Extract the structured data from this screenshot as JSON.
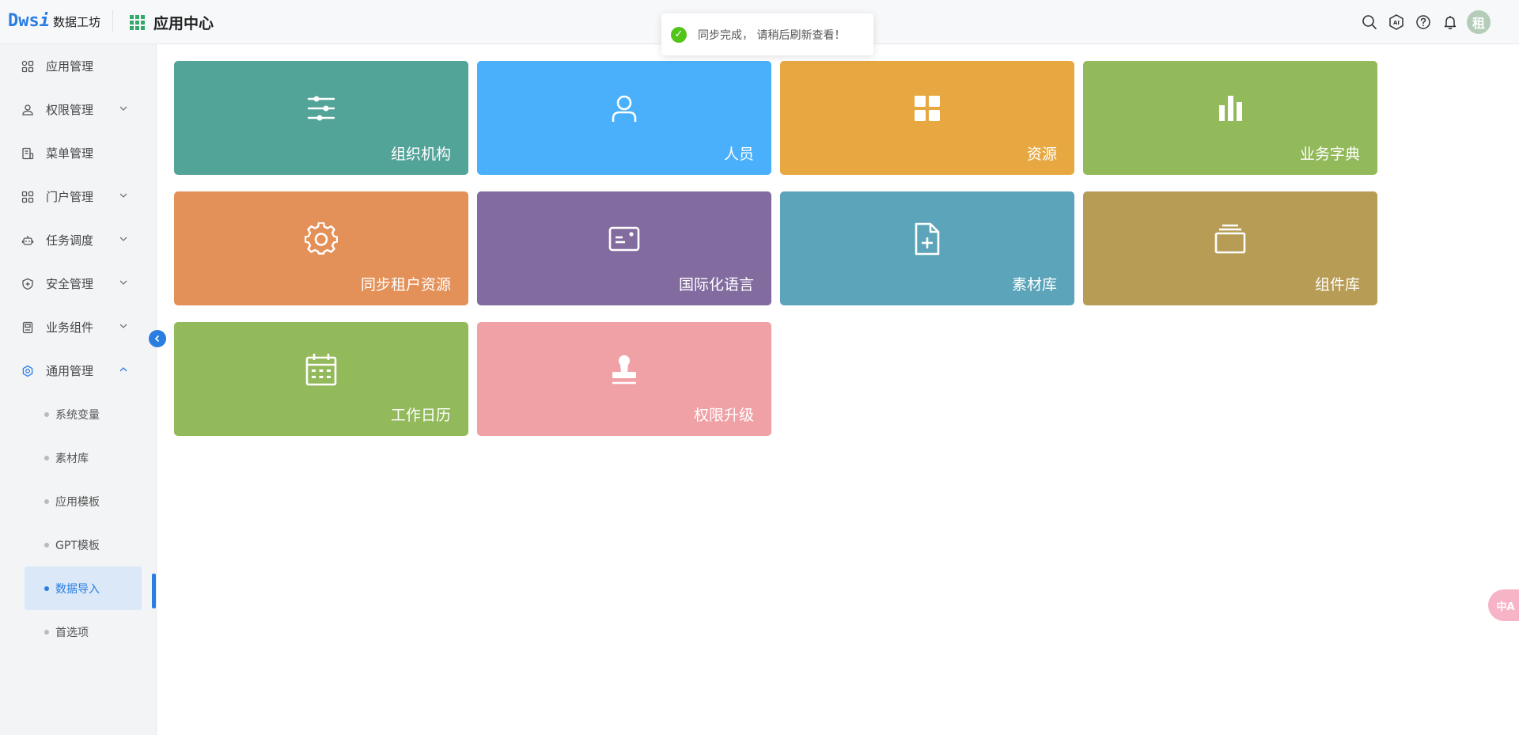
{
  "header": {
    "logo_mark": "Dws",
    "logo_mark_i": "i",
    "logo_text": "数据工坊",
    "app_title": "应用中心",
    "avatar_text": "租"
  },
  "toast": {
    "message": "同步完成， 请稍后刷新查看！"
  },
  "sidebar": {
    "items": [
      {
        "label": "应用管理",
        "icon": "apps-icon",
        "expandable": false
      },
      {
        "label": "权限管理",
        "icon": "user-stamp-icon",
        "expandable": true
      },
      {
        "label": "菜单管理",
        "icon": "menu-doc-icon",
        "expandable": false
      },
      {
        "label": "门户管理",
        "icon": "portal-grid-icon",
        "expandable": true
      },
      {
        "label": "任务调度",
        "icon": "robot-icon",
        "expandable": true
      },
      {
        "label": "安全管理",
        "icon": "shield-icon",
        "expandable": true
      },
      {
        "label": "业务组件",
        "icon": "component-icon",
        "expandable": true
      },
      {
        "label": "通用管理",
        "icon": "gear-icon",
        "expandable": true,
        "expanded": true
      }
    ],
    "sub_items": [
      {
        "label": "系统变量"
      },
      {
        "label": "素材库"
      },
      {
        "label": "应用模板"
      },
      {
        "label": "GPT模板"
      },
      {
        "label": "数据导入",
        "selected": true
      },
      {
        "label": "首选项"
      }
    ]
  },
  "tiles": [
    {
      "label": "组织机构",
      "icon": "sliders-icon",
      "color": "#52a398"
    },
    {
      "label": "人员",
      "icon": "person-icon",
      "color": "#4ab0fb"
    },
    {
      "label": "资源",
      "icon": "grid-squares-icon",
      "color": "#e7a842"
    },
    {
      "label": "业务字典",
      "icon": "bar-chart-icon",
      "color": "#92b95a"
    },
    {
      "label": "同步租户资源",
      "icon": "gear-icon",
      "color": "#e39158"
    },
    {
      "label": "国际化语言",
      "icon": "id-card-icon",
      "color": "#826b9f"
    },
    {
      "label": "素材库",
      "icon": "file-plus-icon",
      "color": "#5ba4b9"
    },
    {
      "label": "组件库",
      "icon": "stack-icon",
      "color": "#b79c56"
    },
    {
      "label": "工作日历",
      "icon": "calendar-icon",
      "color": "#92b95a"
    },
    {
      "label": "权限升级",
      "icon": "stamp-icon",
      "color": "#f0a1a6"
    }
  ],
  "colors": {
    "accent": "#2a7de1",
    "success": "#52c41a"
  },
  "translate_button": {
    "text": "中A"
  }
}
